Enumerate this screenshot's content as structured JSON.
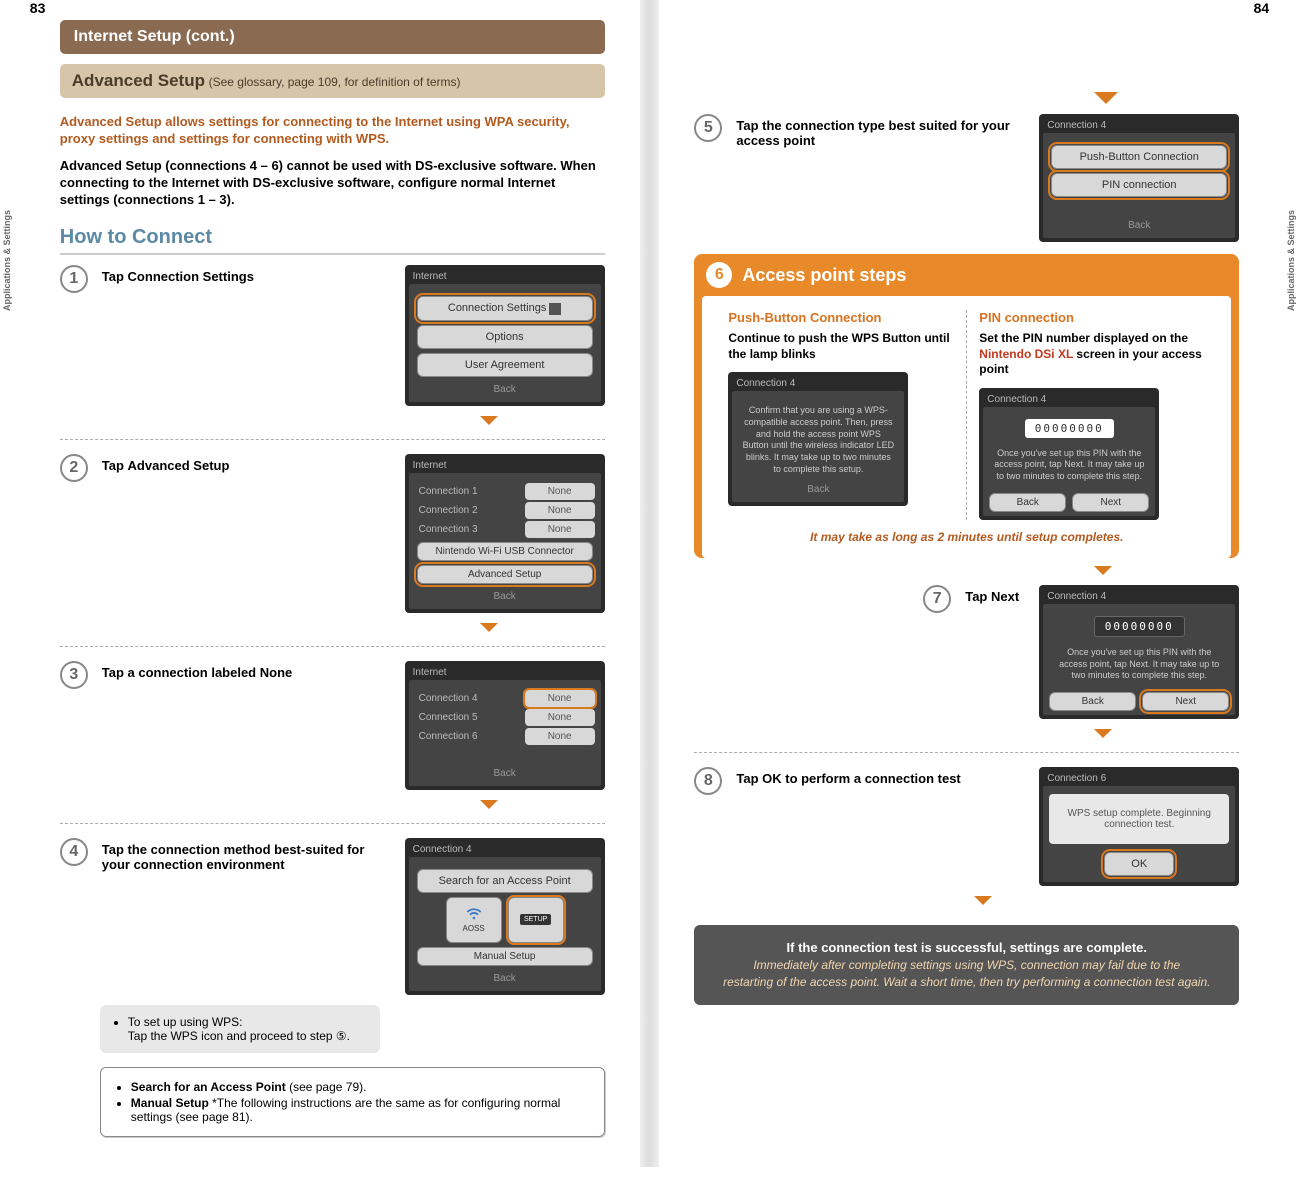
{
  "page_left_num": "83",
  "page_right_num": "84",
  "gutter_label": "Applications & Settings",
  "header": "Internet Setup (cont.)",
  "sub_header_bold": "Advanced Setup",
  "sub_header_rest": " (See glossary, page 109, for definition of terms)",
  "intro_red": "Advanced Setup allows settings for connecting to the Internet using WPA security, proxy settings and settings for connecting with WPS.",
  "intro_black": "Advanced Setup (connections 4 – 6) cannot be used with DS-exclusive software. When connecting to the Internet with DS-exclusive software, configure normal Internet settings (connections 1 – 3).",
  "how_to_connect": "How to Connect",
  "steps": {
    "s1": {
      "num": "1",
      "pre": "Tap ",
      "b": "Connection Settings"
    },
    "s2": {
      "num": "2",
      "pre": "Tap ",
      "b": "Advanced Setup"
    },
    "s3": {
      "num": "3",
      "pre": "Tap a connection labeled ",
      "b": "None"
    },
    "s4": {
      "num": "4",
      "text": "Tap the connection method best-suited for your connection environment"
    },
    "s5": {
      "num": "5",
      "text": "Tap the connection type best suited for your access point"
    },
    "s7": {
      "num": "7",
      "pre": "Tap ",
      "b": "Next"
    },
    "s8": {
      "num": "8",
      "pre": "Tap ",
      "b": "OK",
      "post": " to perform a connection test"
    }
  },
  "screens": {
    "s1": {
      "title": "Internet",
      "btn1": "Connection Settings",
      "btn2": "Options",
      "btn3": "User Agreement",
      "back": "Back"
    },
    "s2": {
      "title": "Internet",
      "c1": "Connection 1",
      "c2": "Connection 2",
      "c3": "Connection 3",
      "none": "None",
      "usb": "Nintendo Wi-Fi USB Connector",
      "adv": "Advanced Setup",
      "back": "Back"
    },
    "s3": {
      "title": "Internet",
      "c4": "Connection 4",
      "c5": "Connection 5",
      "c6": "Connection 6",
      "none": "None",
      "back": "Back"
    },
    "s4": {
      "title": "Connection 4",
      "search": "Search for an Access Point",
      "aoss": "AOSS",
      "wps": "SETUP",
      "manual": "Manual Setup",
      "back": "Back"
    },
    "s5": {
      "title": "Connection 4",
      "push": "Push-Button Connection",
      "pin": "PIN connection",
      "back": "Back"
    },
    "s6a": {
      "title": "Connection 4",
      "msg": "Confirm that you are using a WPS-compatible access point. Then, press and hold the access point WPS Button until the wireless indicator LED blinks. It may take up to two minutes to complete this setup.",
      "back": "Back"
    },
    "s6b": {
      "title": "Connection 4",
      "pin": "00000000",
      "msg": "Once you've set up this PIN with the access point, tap Next. It may take up to two minutes to complete this step.",
      "back": "Back",
      "next": "Next"
    },
    "s7": {
      "title": "Connection 4",
      "pin": "00000000",
      "msg": "Once you've set up this PIN with the access point, tap Next. It may take up to two minutes to complete this step.",
      "back": "Back",
      "next": "Next"
    },
    "s8": {
      "title": "Connection 6",
      "msg": "WPS setup complete. Beginning connection test.",
      "ok": "OK"
    }
  },
  "tip": {
    "line1": "To set up using WPS:",
    "line2": "Tap the WPS icon and proceed to step ⑤."
  },
  "info": {
    "l1b": "Search for an Access Point",
    "l1r": " (see page 79).",
    "l2b": "Manual Setup ",
    "l2r": " *The following instructions are the same as for configuring normal settings (see page 81)."
  },
  "panel6": {
    "num": "6",
    "title": "Access point steps",
    "colA_title": "Push-Button Connection",
    "colA_text": "Continue to push the WPS Button until the lamp blinks",
    "colB_title": "PIN connection",
    "colB_pre": "Set the PIN number displayed on the ",
    "colB_red": "Nintendo DSi XL",
    "colB_post": " screen in your access point",
    "note": "It may take as long as 2 minutes until setup completes."
  },
  "final": {
    "bold": "If the connection test is successful, settings are complete.",
    "it1": "Immediately after completing settings using WPS, connection may fail due to the",
    "it2": "restarting of the access point. Wait a short time, then try performing a connection test again."
  }
}
